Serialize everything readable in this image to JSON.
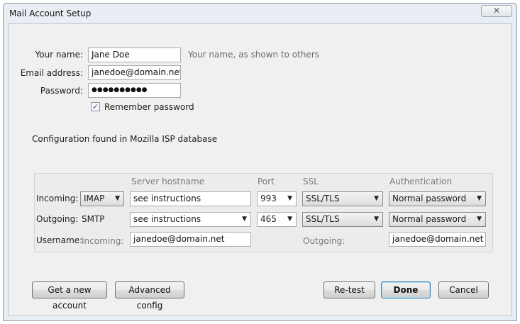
{
  "window": {
    "title": "Mail Account Setup",
    "close_symbol": "✕"
  },
  "identity": {
    "name_label": "Your name:",
    "name_value": "Jane Doe",
    "name_hint": "Your name, as shown to others",
    "email_label": "Email address:",
    "email_value": "janedoe@domain.net",
    "password_label": "Password:",
    "password_value": "●●●●●●●●●●",
    "remember_label": "Remember password",
    "remember_checked": true,
    "remember_check_mark": "✓"
  },
  "status": {
    "message": "Configuration found in Mozilla ISP database"
  },
  "server_table": {
    "headers": {
      "hostname": "Server hostname",
      "port": "Port",
      "ssl": "SSL",
      "auth": "Authentication"
    },
    "incoming": {
      "label": "Incoming:",
      "protocol": "IMAP",
      "hostname": "see instructions",
      "port": "993",
      "ssl": "SSL/TLS",
      "auth": "Normal password"
    },
    "outgoing": {
      "label": "Outgoing:",
      "protocol": "SMTP",
      "hostname": "see instructions",
      "port": "465",
      "ssl": "SSL/TLS",
      "auth": "Normal password"
    },
    "username": {
      "label": "Username:",
      "incoming_label": "Incoming:",
      "incoming_value": "janedoe@domain.net",
      "outgoing_label": "Outgoing:",
      "outgoing_value": "janedoe@domain.net"
    },
    "dropdown_arrow": "▼"
  },
  "buttons": {
    "new_account": "Get a new account",
    "advanced_config": "Advanced config",
    "retest": "Re-test",
    "done": "Done",
    "cancel": "Cancel"
  }
}
